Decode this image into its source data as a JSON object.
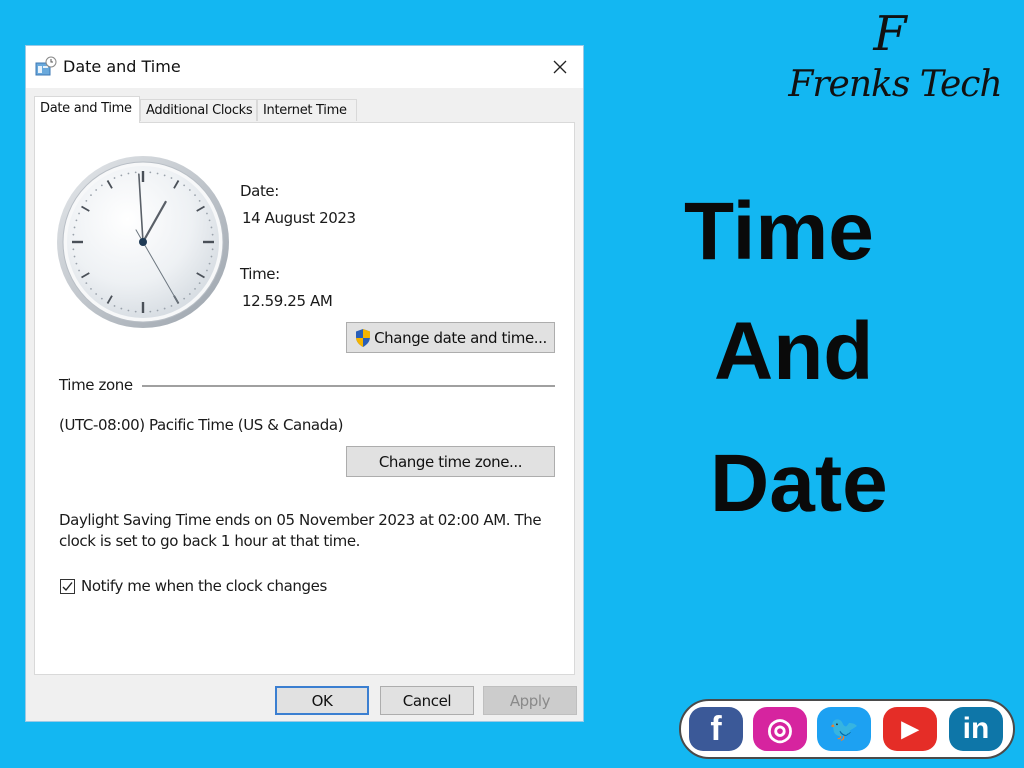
{
  "dialog": {
    "title": "Date and Time",
    "tabs": [
      {
        "label": "Date and Time",
        "active": true
      },
      {
        "label": "Additional Clocks",
        "active": false
      },
      {
        "label": "Internet Time",
        "active": false
      }
    ],
    "date_label": "Date:",
    "date_value": "14 August 2023",
    "time_label": "Time:",
    "time_value": "12.59.25 AM",
    "clock": {
      "hours": 0,
      "minutes": 59,
      "seconds": 25
    },
    "change_datetime_button": "Change date and time...",
    "timezone_heading": "Time zone",
    "timezone_value": "(UTC-08:00) Pacific Time (US & Canada)",
    "change_timezone_button": "Change time zone...",
    "dst_info": "Daylight Saving Time ends on 05 November 2023 at 02:00 AM. The clock is set to go back 1 hour at that time.",
    "notify_checkbox": {
      "label": "Notify me when the clock changes",
      "checked": true
    },
    "buttons": {
      "ok": "OK",
      "cancel": "Cancel",
      "apply": "Apply"
    }
  },
  "branding": {
    "logo_monogram": "F",
    "logo_name": "Frenks Tech",
    "headline": [
      "Time",
      "And",
      "Date"
    ]
  },
  "social": [
    {
      "name": "facebook",
      "glyph": "f",
      "color": "#3b5998"
    },
    {
      "name": "instagram",
      "glyph": "◎",
      "color": "#d6249f"
    },
    {
      "name": "twitter",
      "glyph": "🐦",
      "color": "#1da1f2"
    },
    {
      "name": "youtube",
      "glyph": "▶",
      "color": "#e52d27"
    },
    {
      "name": "linkedin",
      "glyph": "in",
      "color": "#0e76a8"
    }
  ],
  "colors": {
    "background": "#13b7f2",
    "default_button_border": "#3b7fd1",
    "uac_shield_blue": "#2a5fb8",
    "uac_shield_yellow": "#f5b400"
  }
}
